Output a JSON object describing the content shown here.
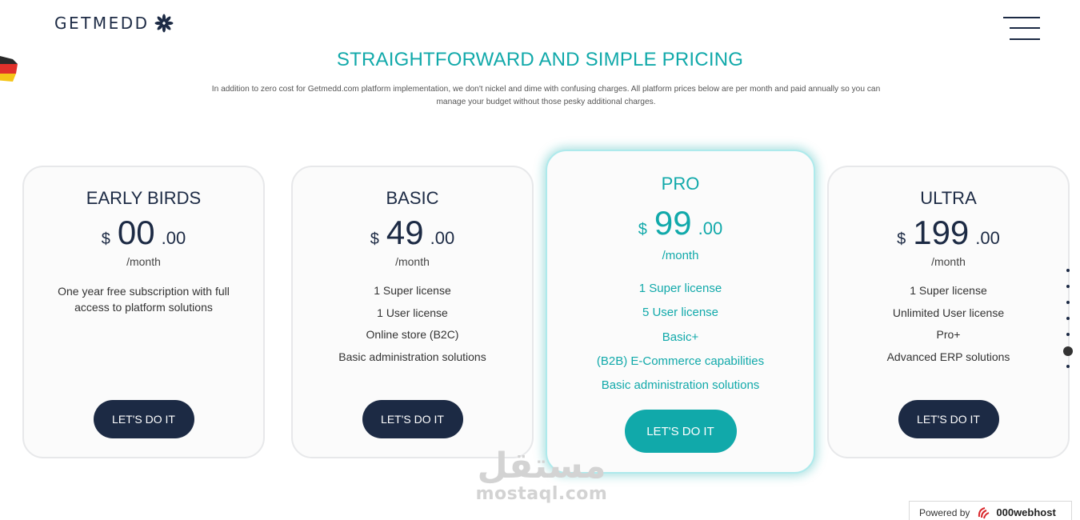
{
  "header": {
    "logo_text": "GETMEDD",
    "logo_icon": "asterisk-flower-icon",
    "menu_icon": "hamburger-menu-icon"
  },
  "pricing": {
    "title": "STRAIGHTFORWARD AND SIMPLE PRICING",
    "intro_line1": "In addition to zero cost for Getmedd.com platform implementation, we don't nickel and dime with confusing charges. All platform prices below are per month and paid annually so you can",
    "intro_line2": "manage your budget without those pesky additional charges."
  },
  "plans": [
    {
      "name": "EARLY BIRDS",
      "currency": "$",
      "amount": "00",
      "decimals": ".00",
      "period": "/month",
      "description_line1": "One year free subscription with full",
      "description_line2": "access to platform solutions",
      "features": [],
      "button": "LET'S DO IT"
    },
    {
      "name": "BASIC",
      "currency": "$",
      "amount": "49",
      "decimals": ".00",
      "period": "/month",
      "features": [
        "1 Super license",
        "1 User license",
        "Online store (B2C)",
        "Basic administration solutions"
      ],
      "button": "LET'S DO IT"
    },
    {
      "name": "PRO",
      "currency": "$",
      "amount": "99",
      "decimals": ".00",
      "period": "/month",
      "features": [
        "1 Super license",
        "5 User license",
        "Basic+",
        "(B2B) E-Commerce capabilities",
        "Basic administration solutions"
      ],
      "button": "LET'S DO IT"
    },
    {
      "name": "ULTRA",
      "currency": "$",
      "amount": "199",
      "decimals": ".00",
      "period": "/month",
      "features": [
        "1 Super license",
        "Unlimited User license",
        "Pro+",
        "Advanced ERP solutions"
      ],
      "button": "LET'S DO IT"
    }
  ],
  "section_nav": {
    "count": 7,
    "active_index": 5
  },
  "watermark": {
    "arabic": "مستقل",
    "latin": "mostaql.com"
  },
  "footer_badge": {
    "prefix": "Powered by",
    "host": "000webhost",
    "icon": "000webhost-logo-icon"
  },
  "colors": {
    "accent": "#11a9aa",
    "navy": "#1c2a44",
    "card_border": "#e7e8ea"
  }
}
